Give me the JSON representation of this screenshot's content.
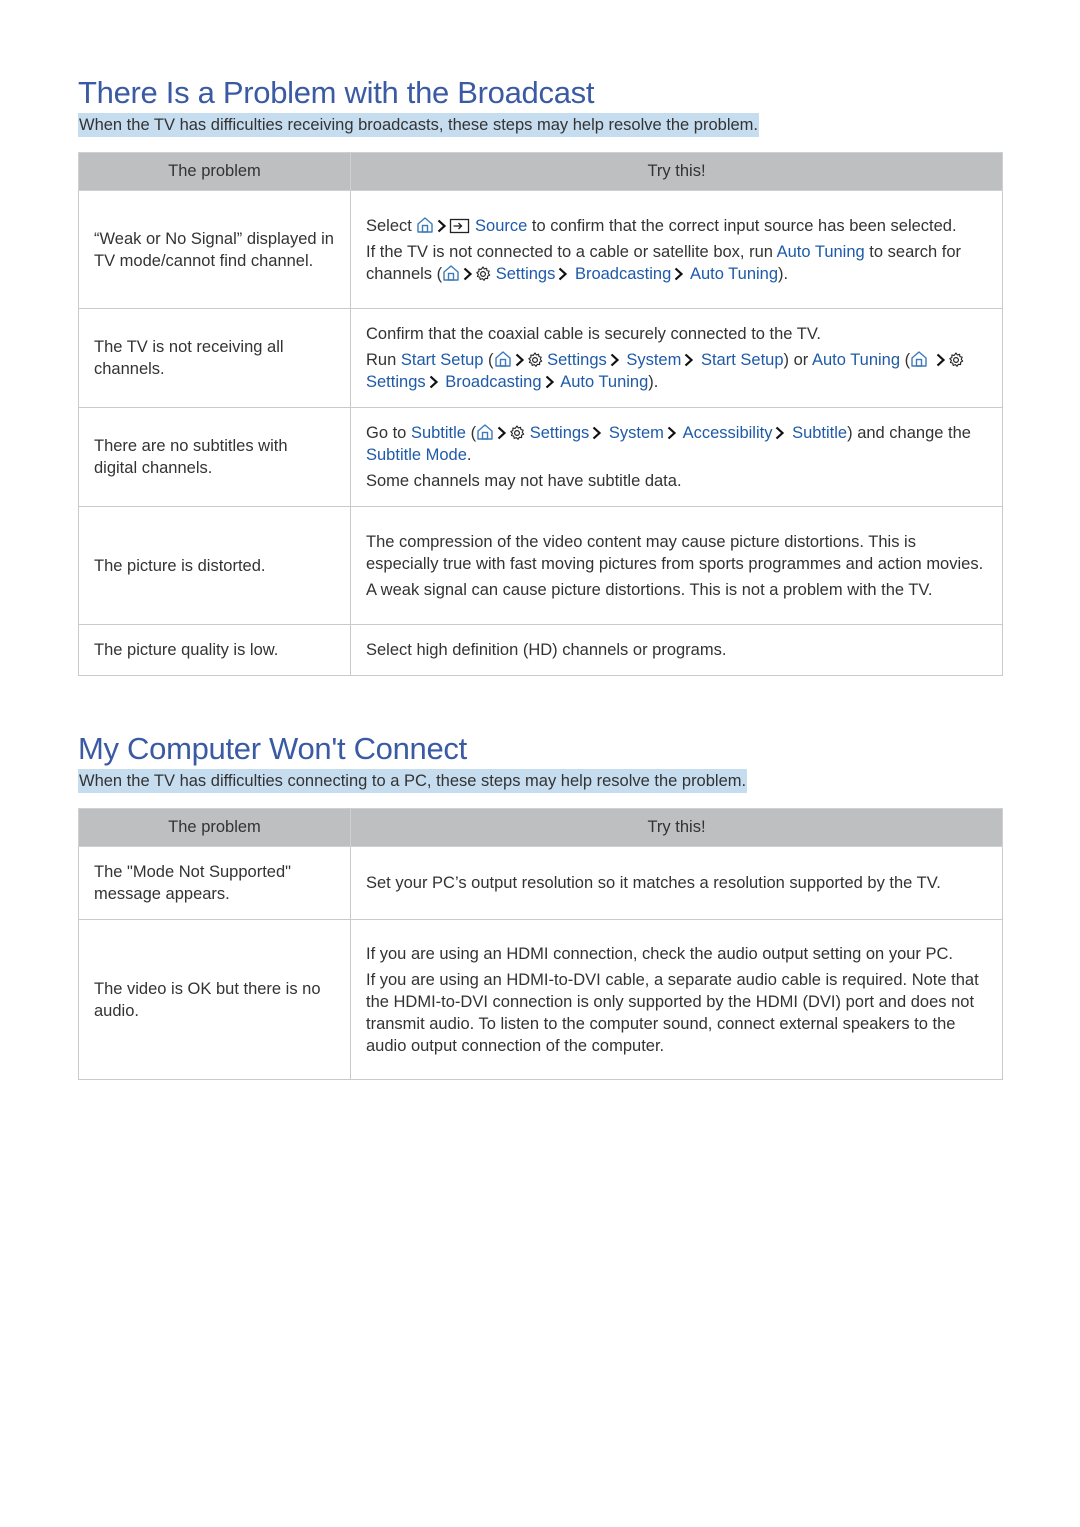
{
  "sections": [
    {
      "title": "There Is a Problem with the Broadcast",
      "intro": "When the TV has difficulties receiving broadcasts, these steps may help resolve the problem.",
      "headers": {
        "problem": "The problem",
        "try": "Try this!"
      },
      "rows": [
        {
          "problem": "“Weak or No Signal” displayed in TV mode/cannot find channel.",
          "r1": {
            "a": "Select",
            "source": "Source",
            "b": "to confirm that the correct input source has been selected."
          },
          "r2": {
            "a": "If the TV is not connected to a cable or satellite box, run",
            "auto_tuning": "Auto Tuning",
            "b": "to search for channels (",
            "settings": "Settings",
            "broadcasting": "Broadcasting",
            "auto_tuning2": "Auto Tuning",
            "c": ")."
          }
        },
        {
          "problem": "The TV is not receiving all channels.",
          "r1": "Confirm that the coaxial cable is securely connected to the TV.",
          "r2": {
            "a": "Run",
            "start_setup": "Start Setup",
            "b": "(",
            "settings": "Settings",
            "system": "System",
            "start_setup2": "Start Setup",
            "c": ") or",
            "auto_tuning": "Auto Tuning",
            "d": "(",
            "settings2": "Settings",
            "broadcasting": "Broadcasting",
            "auto_tuning2": "Auto Tuning",
            "e": ")."
          }
        },
        {
          "problem": "There are no subtitles with digital channels.",
          "r1": {
            "a": "Go to",
            "subtitle": "Subtitle",
            "b": "(",
            "settings": "Settings",
            "system": "System",
            "accessibility": "Accessibility",
            "subtitle2": "Subtitle",
            "c": ") and change the",
            "subtitle_mode": "Subtitle Mode",
            "d": "."
          },
          "r2": "Some channels may not have subtitle data."
        },
        {
          "problem": "The picture is distorted.",
          "r1": "The compression of the video content may cause picture distortions. This is especially true with fast moving pictures from sports programmes and action movies.",
          "r2": "A weak signal can cause picture distortions. This is not a problem with the TV."
        },
        {
          "problem": "The picture quality is low.",
          "r1": "Select high definition (HD) channels or programs."
        }
      ]
    },
    {
      "title": "My Computer Won't Connect",
      "intro": "When the TV has difficulties connecting to a PC, these steps may help resolve the problem.",
      "headers": {
        "problem": "The problem",
        "try": "Try this!"
      },
      "rows": [
        {
          "problem": "The \"Mode Not Supported\" message appears.",
          "r1": "Set your PC’s output resolution so it matches a resolution supported by the TV."
        },
        {
          "problem": "The video is OK but there is no audio.",
          "r1": "If you are using an HDMI connection, check the audio output setting on your PC.",
          "r2": "If you are using an HDMI-to-DVI cable, a separate audio cable is required. Note that the HDMI-to-DVI connection is only supported by the HDMI (DVI) port and does not transmit audio. To listen to the computer sound, connect external speakers to the audio output connection of the computer."
        }
      ]
    }
  ],
  "colors": {
    "title": "#3a5aa3",
    "link": "#1e5aa8",
    "highlight": "#c6dcef",
    "header_bg": "#bebfc1"
  }
}
